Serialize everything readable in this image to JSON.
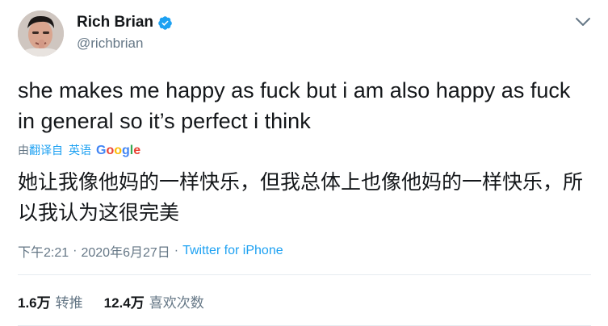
{
  "author": {
    "display_name": "Rich Brian",
    "handle": "@richbrian",
    "verified_icon": "verified-badge-icon"
  },
  "tweet": {
    "text": "she makes me happy as fuck but i am also happy as fuck in general so it’s perfect i think",
    "translation": {
      "prefix": "由",
      "link_label": "翻译自",
      "language": "英语",
      "provider": "Google",
      "text": "她让我像他妈的一样快乐，但我总体上也像他妈的一样快乐，所以我认为这很完美"
    },
    "time": "下午2:21",
    "date": "2020年6月27日",
    "separator": "·",
    "source": "Twitter for iPhone"
  },
  "stats": {
    "retweets": {
      "count": "1.6万",
      "label": "转推"
    },
    "likes": {
      "count": "12.4万",
      "label": "喜欢次数"
    }
  },
  "colors": {
    "accent": "#1da1f2",
    "secondary_text": "#657786",
    "primary_text": "#14171a",
    "divider": "#e6ecf0"
  }
}
